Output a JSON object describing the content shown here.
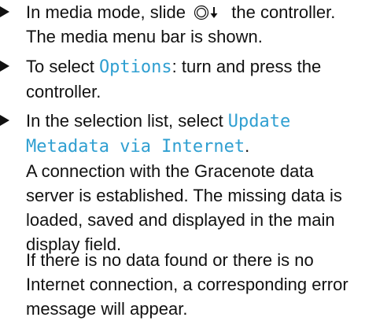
{
  "steps": [
    {
      "line1_before": "In media mode, slide",
      "icon": "controller-slide-down-icon",
      "line1_after": "the controller.",
      "line2": "The media menu bar is shown."
    },
    {
      "line1_before": "To select ",
      "option": "Options",
      "line1_after": ": turn and press the",
      "line2": "controller."
    },
    {
      "line1_before": "In the selection list, select ",
      "option_line1": "Update",
      "option_line2": "Metadata via Internet",
      "line2_after": ".",
      "result_lines": [
        "A connection with the Gracenote data",
        "server is established. The missing data is",
        "loaded, saved and displayed in the main",
        "display field."
      ]
    }
  ],
  "note_lines": [
    "If there is no data found or there is no",
    "Internet connection, a corresponding error",
    "message will appear."
  ],
  "colors": {
    "highlight": "#2f9fd1",
    "text": "#111111"
  }
}
